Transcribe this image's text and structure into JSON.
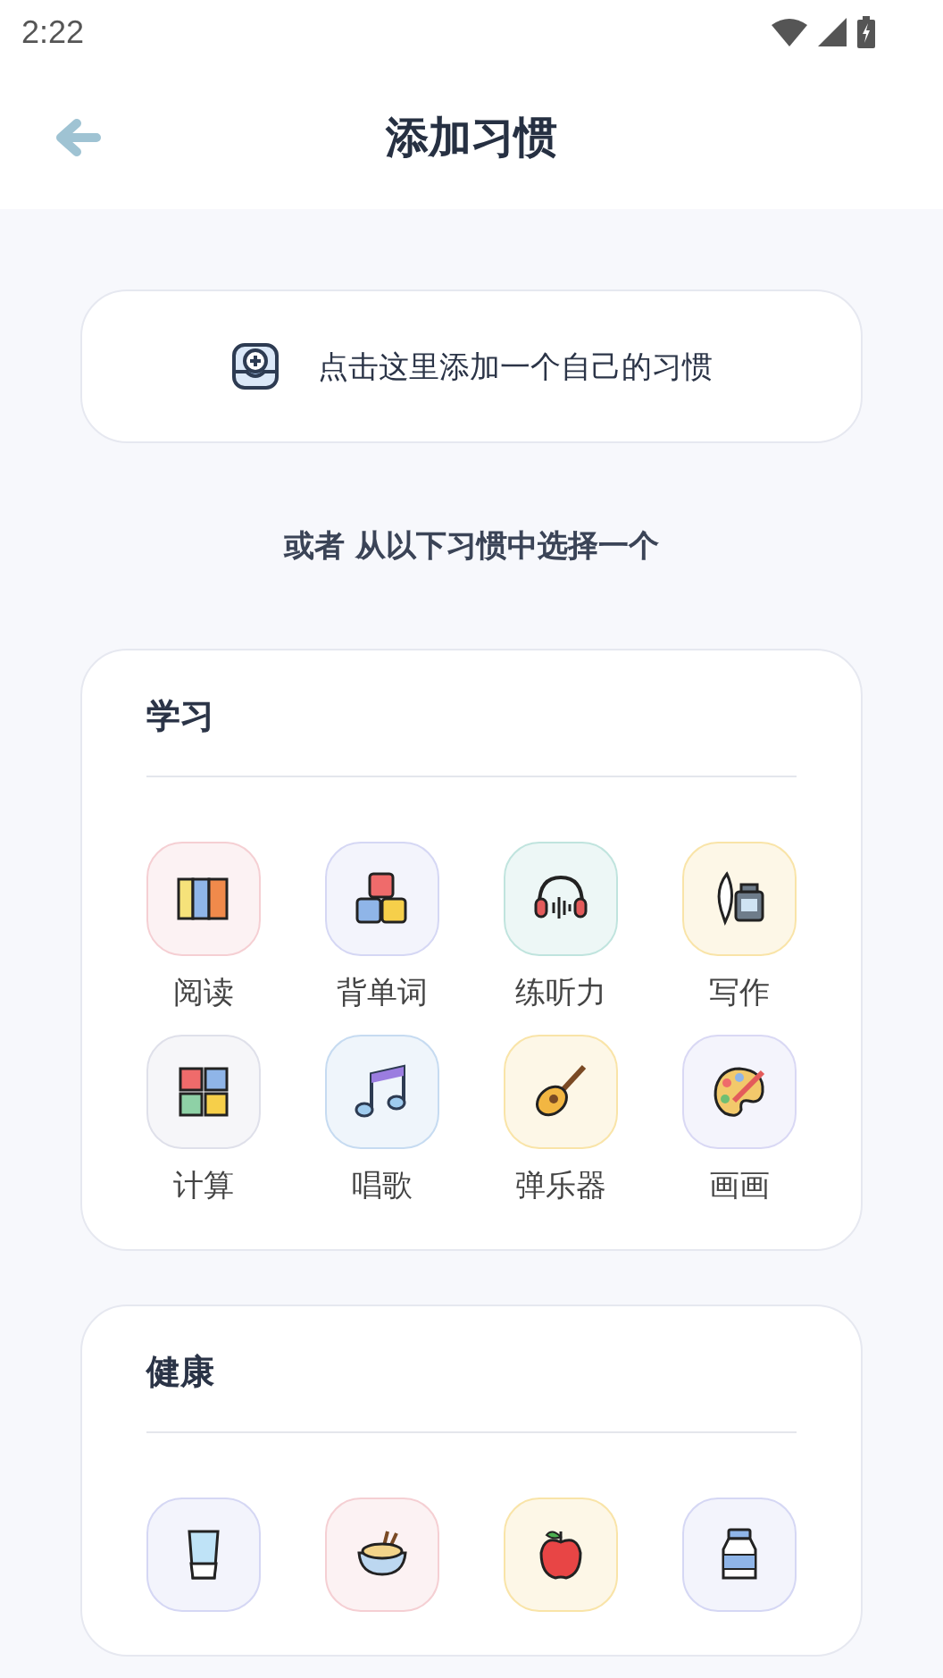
{
  "status_bar": {
    "time": "2:22"
  },
  "header": {
    "title": "添加习惯"
  },
  "custom_button": {
    "label": "点击这里添加一个自己的习惯"
  },
  "hint": "或者 从以下习惯中选择一个",
  "sections": [
    {
      "title": "学习",
      "items": [
        {
          "label": "阅读",
          "color": "#f5cfd3"
        },
        {
          "label": "背单词",
          "color": "#d5d7f4"
        },
        {
          "label": "练听力",
          "color": "#c0e4de"
        },
        {
          "label": "写作",
          "color": "#f9e4a8"
        },
        {
          "label": "计算",
          "color": "#dfe0ea"
        },
        {
          "label": "唱歌",
          "color": "#c6dbf1"
        },
        {
          "label": "弹乐器",
          "color": "#f9e4a8"
        },
        {
          "label": "画画",
          "color": "#d9d8f4"
        }
      ]
    },
    {
      "title": "健康",
      "items": [
        {
          "color": "#d5d7f4"
        },
        {
          "color": "#f5cfd3"
        },
        {
          "color": "#f9e4a8"
        },
        {
          "color": "#d5d7f4"
        }
      ]
    }
  ]
}
